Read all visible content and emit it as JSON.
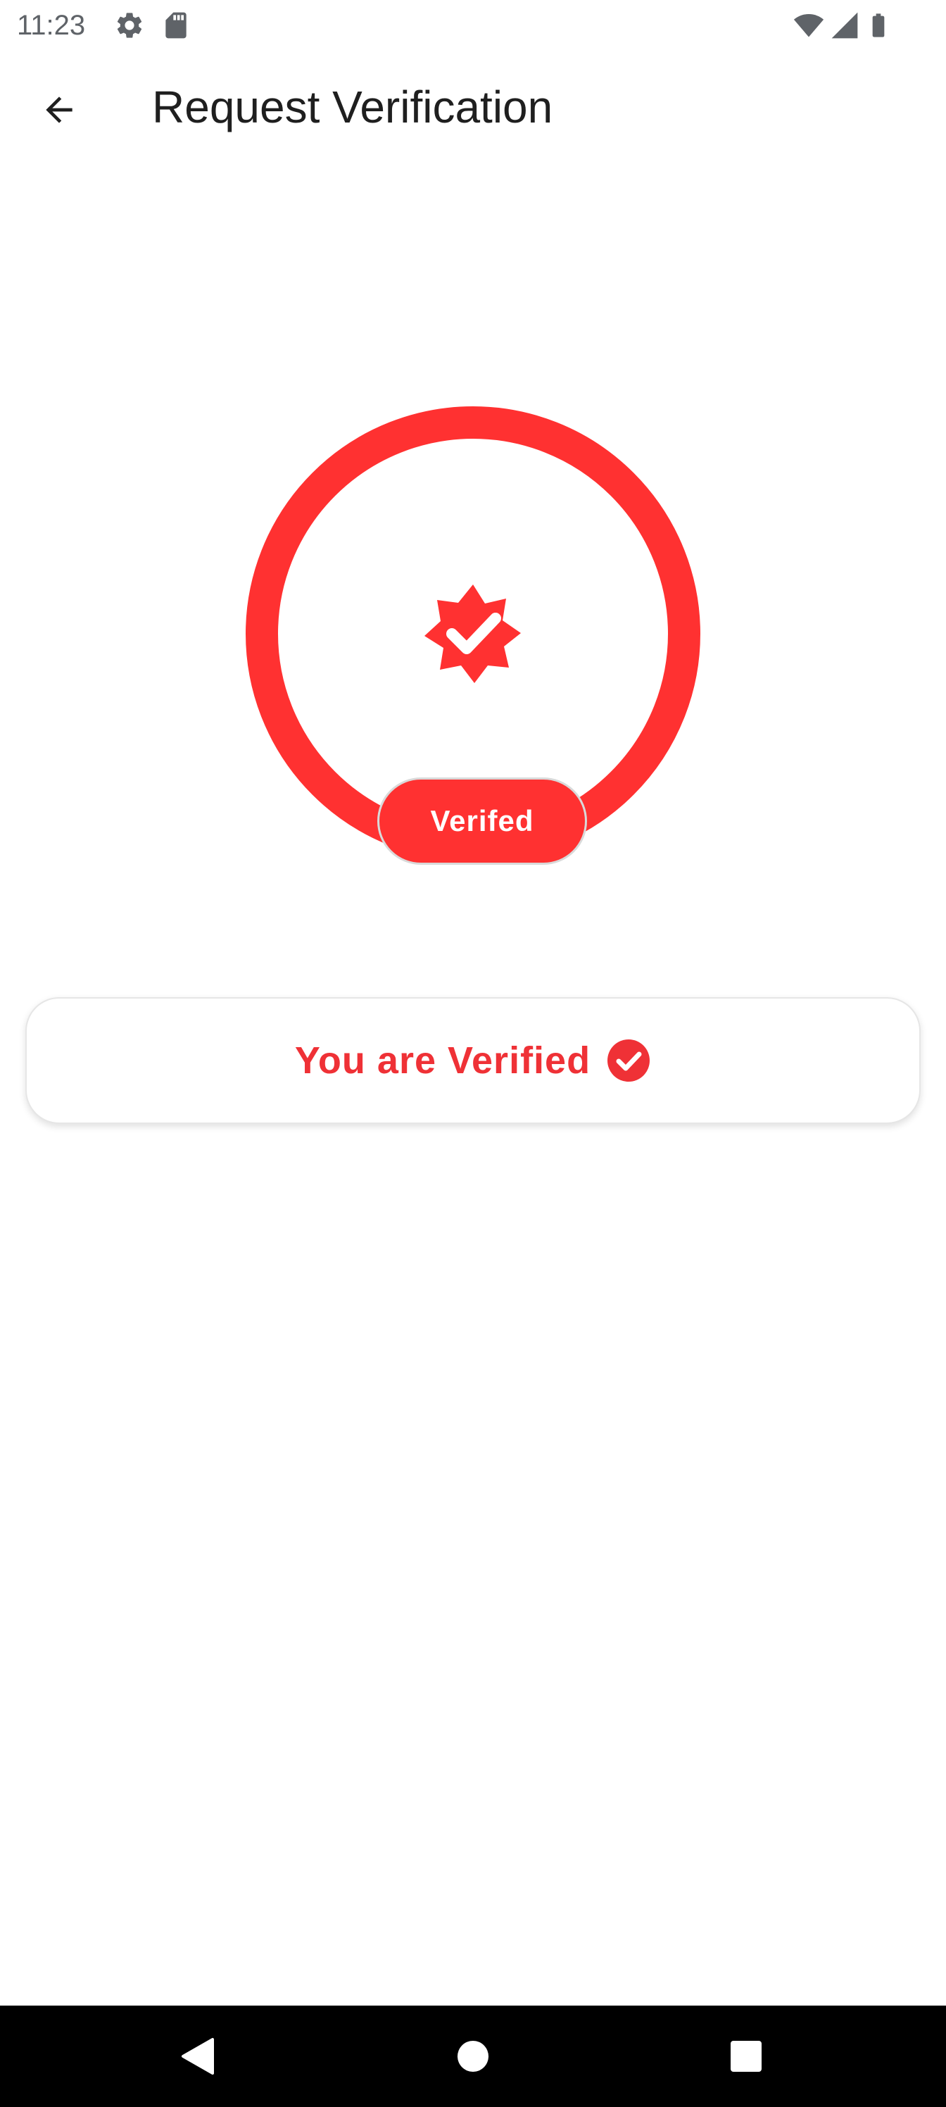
{
  "status_bar": {
    "time": "11:23",
    "left_icons": [
      "settings-gear-icon",
      "sd-card-icon"
    ],
    "right_icons": [
      "wifi-icon",
      "cell-signal-icon",
      "battery-icon"
    ]
  },
  "app_bar": {
    "back_icon": "arrow-back-icon",
    "title": "Request Verification"
  },
  "verification_status": {
    "badge_icon": "verified-badge-icon",
    "pill_label": "Verifed",
    "ring_color": "#ff3131"
  },
  "verified_card": {
    "message": "You are Verified",
    "check_icon": "check-circle-icon",
    "accent_color": "#ef3136"
  },
  "nav_bar": {
    "buttons": [
      "nav-back-icon",
      "nav-home-icon",
      "nav-recents-icon"
    ]
  }
}
